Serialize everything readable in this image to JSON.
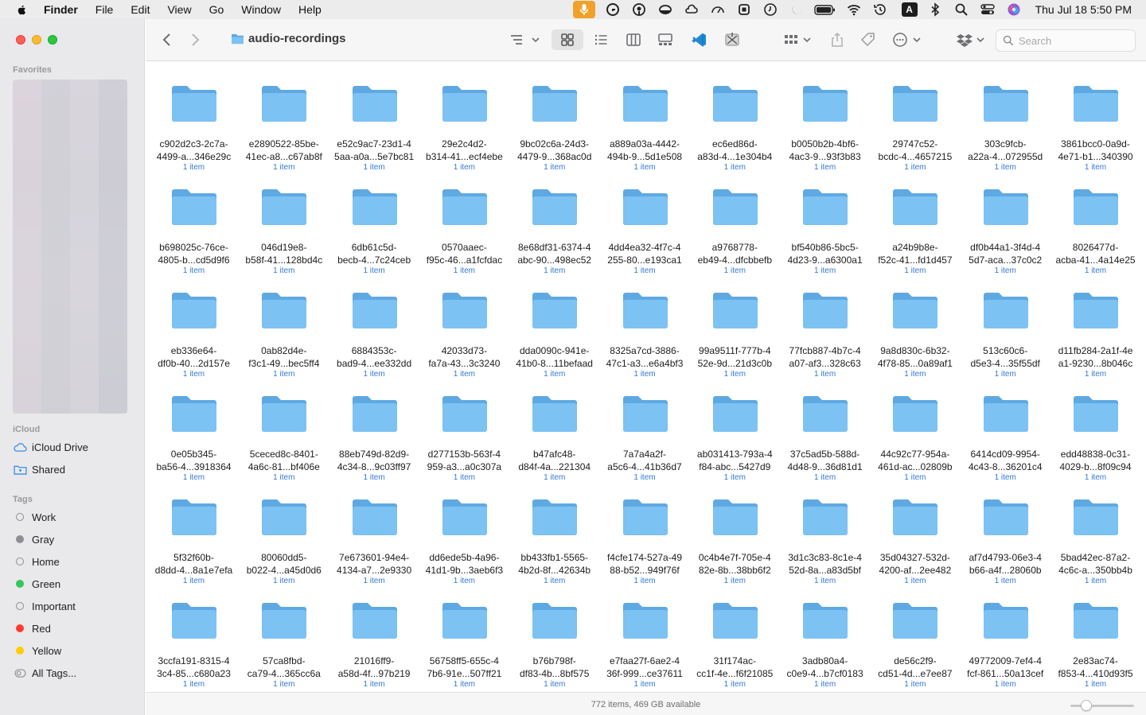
{
  "menubar": {
    "apple_icon": "apple-logo-icon",
    "items": [
      "Finder",
      "File",
      "Edit",
      "View",
      "Go",
      "Window",
      "Help"
    ],
    "keyboard_input": "A",
    "datetime": "Thu Jul 18  5:50 PM"
  },
  "sidebar": {
    "favorites_title": "Favorites",
    "icloud_title": "iCloud",
    "icloud_items": [
      {
        "label": "iCloud Drive",
        "icon": "cloud-icon"
      },
      {
        "label": "Shared",
        "icon": "shared-folder-icon"
      }
    ],
    "tags_title": "Tags",
    "tags": [
      {
        "label": "Work",
        "color": "",
        "hollow": true
      },
      {
        "label": "Gray",
        "color": "#8e8e93",
        "hollow": false
      },
      {
        "label": "Home",
        "color": "",
        "hollow": true
      },
      {
        "label": "Green",
        "color": "#34c759",
        "hollow": false
      },
      {
        "label": "Important",
        "color": "",
        "hollow": true
      },
      {
        "label": "Red",
        "color": "#ff3b30",
        "hollow": false
      },
      {
        "label": "Yellow",
        "color": "#ffcc00",
        "hollow": false
      }
    ],
    "all_tags": "All Tags..."
  },
  "toolbar": {
    "folder_title": "audio-recordings",
    "search_placeholder": "Search"
  },
  "colors": {
    "folder_front": "#7cc2f3",
    "folder_back": "#5fa9e3",
    "accent": "#3478d6"
  },
  "folders": [
    {
      "l1": "c902d2c3-2c7a-",
      "l2": "4499-a...346e29c",
      "count": "1 item"
    },
    {
      "l1": "e2890522-85be-",
      "l2": "41ec-a8...c67ab8f",
      "count": "1 item"
    },
    {
      "l1": "e52c9ac7-23d1-4",
      "l2": "5aa-a0a...5e7bc81",
      "count": "1 item"
    },
    {
      "l1": "29e2c4d2-",
      "l2": "b314-41...ecf4ebe",
      "count": "1 item"
    },
    {
      "l1": "9bc02c6a-24d3-",
      "l2": "4479-9...368ac0d",
      "count": "1 item"
    },
    {
      "l1": "a889a03a-4442-",
      "l2": "494b-9...5d1e508",
      "count": "1 item"
    },
    {
      "l1": "ec6ed86d-",
      "l2": "a83d-4...1e304b4",
      "count": "1 item"
    },
    {
      "l1": "b0050b2b-4bf6-",
      "l2": "4ac3-9...93f3b83",
      "count": "1 item"
    },
    {
      "l1": "29747c52-",
      "l2": "bcdc-4...4657215",
      "count": "1 item"
    },
    {
      "l1": "303c9fcb-",
      "l2": "a22a-4...072955d",
      "count": "1 item"
    },
    {
      "l1": "3861bcc0-0a9d-",
      "l2": "4e71-b1...340390",
      "count": "1 item"
    },
    {
      "l1": "b698025c-76ce-",
      "l2": "4805-b...cd5d9f6",
      "count": "1 item"
    },
    {
      "l1": "046d19e8-",
      "l2": "b58f-41...128bd4c",
      "count": "1 item"
    },
    {
      "l1": "6db61c5d-",
      "l2": "becb-4...7c24ceb",
      "count": "1 item"
    },
    {
      "l1": "0570aaec-",
      "l2": "f95c-46...a1fcfdac",
      "count": "1 item"
    },
    {
      "l1": "8e68df31-6374-4",
      "l2": "abc-90...498ec52",
      "count": "1 item"
    },
    {
      "l1": "4dd4ea32-4f7c-4",
      "l2": "255-80...e193ca1",
      "count": "1 item"
    },
    {
      "l1": "a9768778-",
      "l2": "eb49-4...dfcbbefb",
      "count": "1 item"
    },
    {
      "l1": "bf540b86-5bc5-",
      "l2": "4d23-9...a6300a1",
      "count": "1 item"
    },
    {
      "l1": "a24b9b8e-",
      "l2": "f52c-41...fd1d457",
      "count": "1 item"
    },
    {
      "l1": "df0b44a1-3f4d-4",
      "l2": "5d7-aca...37c0c2",
      "count": "1 item"
    },
    {
      "l1": "8026477d-",
      "l2": "acba-41...4a14e25",
      "count": "1 item"
    },
    {
      "l1": "eb336e64-",
      "l2": "df0b-40...2d157e",
      "count": "1 item"
    },
    {
      "l1": "0ab82d4e-",
      "l2": "f3c1-49...bec5ff4",
      "count": "1 item"
    },
    {
      "l1": "6884353c-",
      "l2": "bad9-4...ee332dd",
      "count": "1 item"
    },
    {
      "l1": "42033d73-",
      "l2": "fa7a-43...3c3240",
      "count": "1 item"
    },
    {
      "l1": "dda0090c-941e-",
      "l2": "41b0-8...11befaad",
      "count": "1 item"
    },
    {
      "l1": "8325a7cd-3886-",
      "l2": "47c1-a3...e6a4bf3",
      "count": "1 item"
    },
    {
      "l1": "99a9511f-777b-4",
      "l2": "52e-9d...21d3c0b",
      "count": "1 item"
    },
    {
      "l1": "77fcb887-4b7c-4",
      "l2": "a07-af3...328c63",
      "count": "1 item"
    },
    {
      "l1": "9a8d830c-6b32-",
      "l2": "4f78-85...0a89af1",
      "count": "1 item"
    },
    {
      "l1": "513c60c6-",
      "l2": "d5e3-4...35f55df",
      "count": "1 item"
    },
    {
      "l1": "d11fb284-2a1f-4e",
      "l2": "a1-9230...8b046c",
      "count": "1 item"
    },
    {
      "l1": "0e05b345-",
      "l2": "ba56-4...3918364",
      "count": "1 item"
    },
    {
      "l1": "5ceced8c-8401-",
      "l2": "4a6c-81...bf406e",
      "count": "1 item"
    },
    {
      "l1": "88eb749d-82d9-",
      "l2": "4c34-8...9c03ff97",
      "count": "1 item"
    },
    {
      "l1": "d277153b-563f-4",
      "l2": "959-a3...a0c307a",
      "count": "1 item"
    },
    {
      "l1": "b47afc48-",
      "l2": "d84f-4a...221304",
      "count": "1 item"
    },
    {
      "l1": "7a7a4a2f-",
      "l2": "a5c6-4...41b36d7",
      "count": "1 item"
    },
    {
      "l1": "ab031413-793a-4",
      "l2": "f84-abc...5427d9",
      "count": "1 item"
    },
    {
      "l1": "37c5ad5b-588d-",
      "l2": "4d48-9...36d81d1",
      "count": "1 item"
    },
    {
      "l1": "44c92c77-954a-",
      "l2": "461d-ac...02809b",
      "count": "1 item"
    },
    {
      "l1": "6414cd09-9954-",
      "l2": "4c43-8...36201c4",
      "count": "1 item"
    },
    {
      "l1": "edd48838-0c31-",
      "l2": "4029-b...8f09c94",
      "count": "1 item"
    },
    {
      "l1": "5f32f60b-",
      "l2": "d8dd-4...8a1e7efa",
      "count": "1 item"
    },
    {
      "l1": "80060dd5-",
      "l2": "b022-4...a45d0d6",
      "count": "1 item"
    },
    {
      "l1": "7e673601-94e4-",
      "l2": "4134-a7...2e9330",
      "count": "1 item"
    },
    {
      "l1": "dd6ede5b-4a96-",
      "l2": "41d1-9b...3aeb6f3",
      "count": "1 item"
    },
    {
      "l1": "bb433fb1-5565-",
      "l2": "4b2d-8f...42634b",
      "count": "1 item"
    },
    {
      "l1": "f4cfe174-527a-49",
      "l2": "88-b52...949f76f",
      "count": "1 item"
    },
    {
      "l1": "0c4b4e7f-705e-4",
      "l2": "82e-8b...38bb6f2",
      "count": "1 item"
    },
    {
      "l1": "3d1c3c83-8c1e-4",
      "l2": "52d-8a...a83d5bf",
      "count": "1 item"
    },
    {
      "l1": "35d04327-532d-",
      "l2": "4200-af...2ee482",
      "count": "1 item"
    },
    {
      "l1": "af7d4793-06e3-4",
      "l2": "b66-a4f...28060b",
      "count": "1 item"
    },
    {
      "l1": "5bad42ec-87a2-",
      "l2": "4c6c-a...350bb4b",
      "count": "1 item"
    },
    {
      "l1": "3ccfa191-8315-4",
      "l2": "3c4-85...c680a23",
      "count": "1 item"
    },
    {
      "l1": "57ca8fbd-",
      "l2": "ca79-4...365cc6a",
      "count": "1 item"
    },
    {
      "l1": "21016ff9-",
      "l2": "a58d-4f...97b219",
      "count": "1 item"
    },
    {
      "l1": "56758ff5-655c-4",
      "l2": "7b6-91e...507ff21",
      "count": "1 item"
    },
    {
      "l1": "b76b798f-",
      "l2": "df83-4b...8bf575",
      "count": "1 item"
    },
    {
      "l1": "e7faa27f-6ae2-4",
      "l2": "36f-999...ce37611",
      "count": "1 item"
    },
    {
      "l1": "31f174ac-",
      "l2": "cc1f-4e...f6f21085",
      "count": "1 item"
    },
    {
      "l1": "3adb80a4-",
      "l2": "c0e9-4...b7cf0183",
      "count": "1 item"
    },
    {
      "l1": "de56c2f9-",
      "l2": "cd51-4d...e7ee87",
      "count": "1 item"
    },
    {
      "l1": "49772009-7ef4-4",
      "l2": "fcf-861...50a13cef",
      "count": "1 item"
    },
    {
      "l1": "2e83ac74-",
      "l2": "f853-4...410d93f5",
      "count": "1 item"
    }
  ],
  "statusbar": {
    "text": "772 items, 469 GB available",
    "icon_size_level": 0.25
  }
}
